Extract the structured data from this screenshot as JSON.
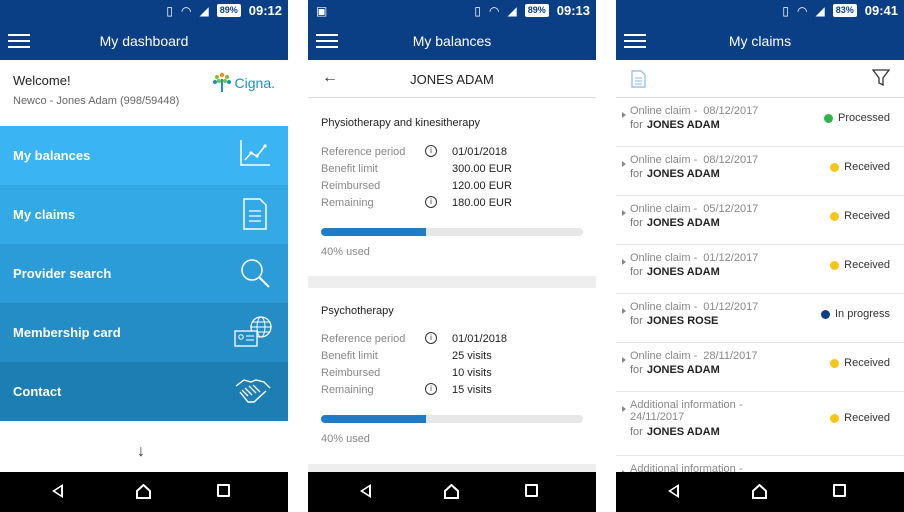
{
  "status_bar": [
    {
      "battery": "89%",
      "time": "09:12"
    },
    {
      "battery": "89%",
      "time": "09:13"
    },
    {
      "battery": "83%",
      "time": "09:41"
    }
  ],
  "dashboard": {
    "title": "My dashboard",
    "welcome": "Welcome!",
    "member": "Newco - Jones Adam (998/59448)",
    "brand": "Cigna.",
    "items": [
      {
        "label": "My balances",
        "color": "#3ab4f2",
        "icon": "chart-icon"
      },
      {
        "label": "My claims",
        "color": "#33a9e6",
        "icon": "document-icon"
      },
      {
        "label": "Provider search",
        "color": "#2c9cd8",
        "icon": "magnifier-icon"
      },
      {
        "label": "Membership card",
        "color": "#258dc6",
        "icon": "id-card-globe-icon"
      },
      {
        "label": "Contact",
        "color": "#1d7eb4",
        "icon": "handshake-icon"
      }
    ],
    "scroll_hint": "↓"
  },
  "balances": {
    "title": "My balances",
    "member_name": "JONES ADAM",
    "cards": [
      {
        "title": "Physiotherapy and kinesitherapy",
        "rows": [
          {
            "label": "Reference period",
            "info": true,
            "value": "01/01/2018"
          },
          {
            "label": "Benefit limit",
            "info": false,
            "value": "300.00 EUR"
          },
          {
            "label": "Reimbursed",
            "info": false,
            "value": "120.00 EUR"
          },
          {
            "label": "Remaining",
            "info": true,
            "value": "180.00 EUR"
          }
        ],
        "used_fraction": 0.4,
        "used_text": "40% used"
      },
      {
        "title": "Psychotherapy",
        "rows": [
          {
            "label": "Reference period",
            "info": true,
            "value": "01/01/2018"
          },
          {
            "label": "Benefit limit",
            "info": false,
            "value": "25 visits"
          },
          {
            "label": "Reimbursed",
            "info": false,
            "value": "10 visits"
          },
          {
            "label": "Remaining",
            "info": true,
            "value": "15 visits"
          }
        ],
        "used_fraction": 0.4,
        "used_text": "40% used"
      }
    ]
  },
  "claims": {
    "title": "My claims",
    "status_colors": {
      "Processed": "#2db34a",
      "Received": "#f5c518",
      "In progress": "#0a3f86"
    },
    "items": [
      {
        "type": "Online claim -",
        "date": "08/12/2017",
        "for": "for",
        "name": "JONES ADAM",
        "status": "Processed"
      },
      {
        "type": "Online claim -",
        "date": "08/12/2017",
        "for": "for",
        "name": "JONES ADAM",
        "status": "Received"
      },
      {
        "type": "Online claim -",
        "date": "05/12/2017",
        "for": "for",
        "name": "JONES ADAM",
        "status": "Received"
      },
      {
        "type": "Online claim -",
        "date": "01/12/2017",
        "for": "for",
        "name": "JONES ADAM",
        "status": "Received"
      },
      {
        "type": "Online claim -",
        "date": "01/12/2017",
        "for": "for",
        "name": "JONES ROSE",
        "status": "In progress"
      },
      {
        "type": "Online claim -",
        "date": "28/11/2017",
        "for": "for",
        "name": "JONES ADAM",
        "status": "Received"
      },
      {
        "type": "Additional information -",
        "date": "24/11/2017",
        "for": "for",
        "name": "JONES ADAM",
        "status": "Received"
      },
      {
        "type": "Additional information -",
        "date": "",
        "for": "",
        "name": "",
        "status": ""
      }
    ]
  }
}
